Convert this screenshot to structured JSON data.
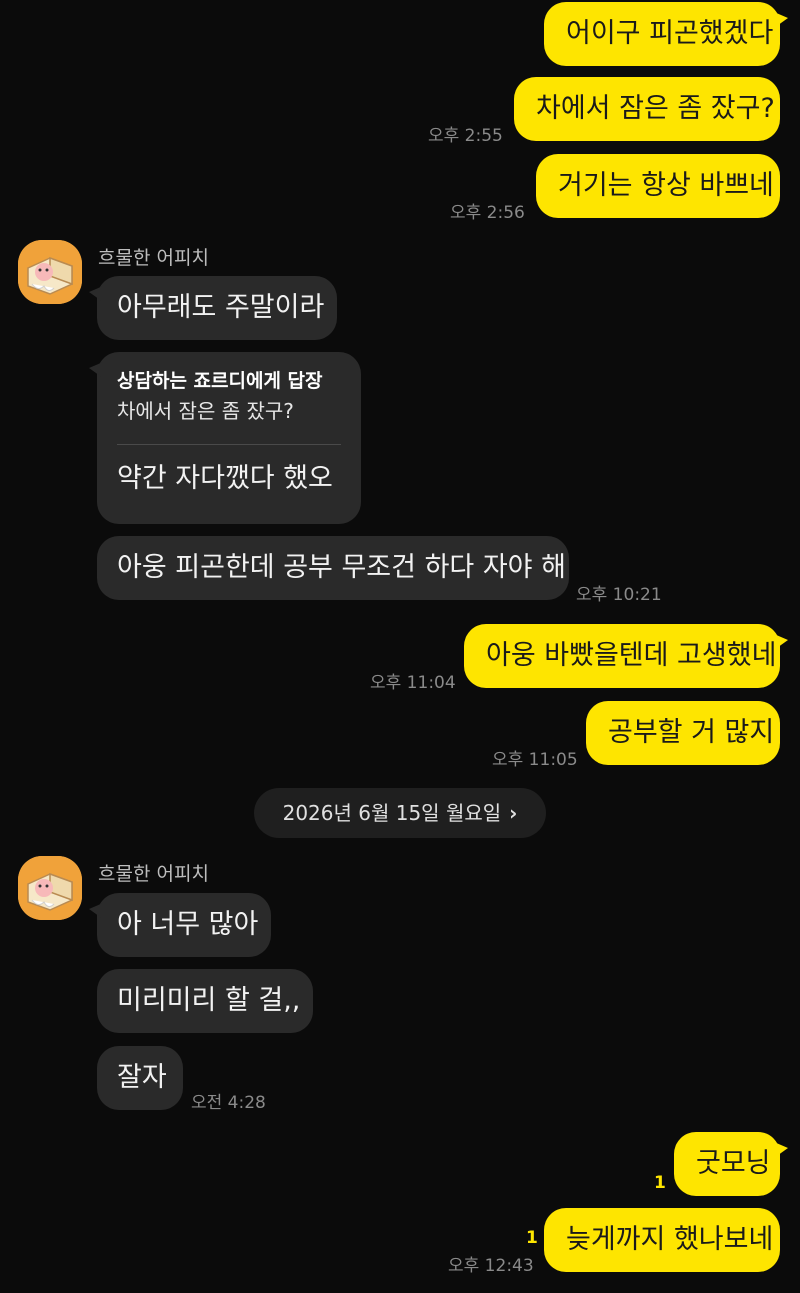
{
  "chat": {
    "sender_name": "흐물한 어피치",
    "date_divider": "2026년 6월 15일 월요일",
    "messages": {
      "m1": "어이구 피곤했겠다",
      "m2": "차에서 잠은 좀 잤구?",
      "m2_time": "오후 2:55",
      "m3": "거기는 항상 바쁘네",
      "m3_time": "오후 2:56",
      "m4": "아무래도 주말이라",
      "reply_title": "상담하는 죠르디에게 답장",
      "reply_quote": "차에서 잠은 좀 잤구?",
      "reply_text": "약간 자다깼다 했오",
      "m6": "아웅 피곤한데 공부 무조건 하다 자야 해",
      "m6_time": "오후 10:21",
      "m7": "아웅 바빴을텐데 고생했네",
      "m7_time": "오후 11:04",
      "m8": "공부할 거 많지",
      "m8_time": "오후 11:05",
      "m9": "아 너무 많아",
      "m10": "미리미리 할 걸,,",
      "m11": "잘자",
      "m11_time": "오전 4:28",
      "m12": "굿모닝",
      "m12_unread": "1",
      "m13": "늦게까지 했나보네",
      "m13_unread": "1",
      "m13_time": "오후 12:43"
    }
  },
  "colors": {
    "outgoing_bubble": "#fee500",
    "incoming_bubble": "#2a2a2a",
    "background": "#0b0b0b",
    "avatar_bg": "#f0a23a"
  },
  "icons": {
    "date_chevron": "chevron-right-icon",
    "avatar": "apeach-avatar-icon"
  }
}
